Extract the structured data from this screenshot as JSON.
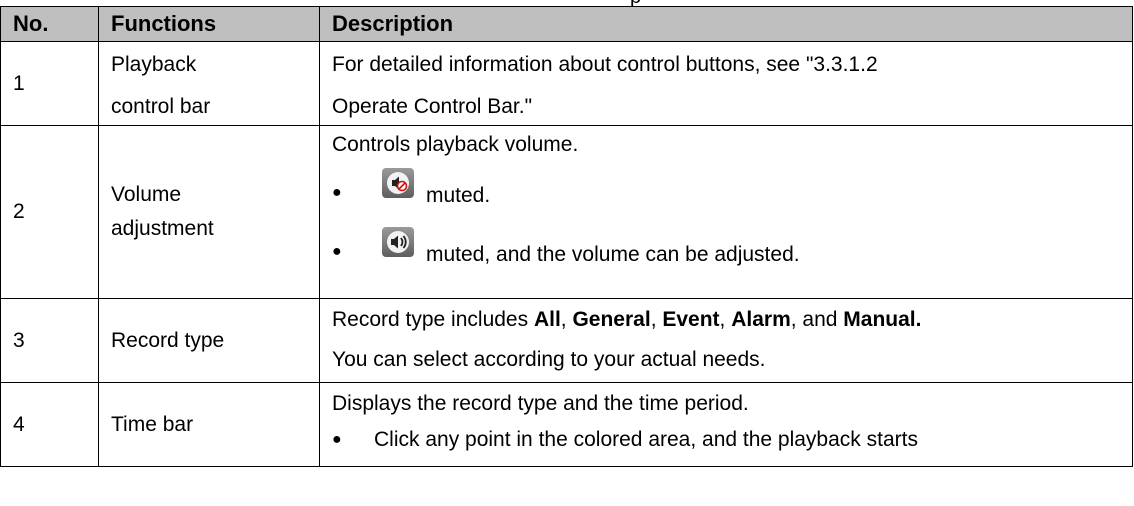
{
  "partial_header_text": "p",
  "table": {
    "headers": {
      "no": "No.",
      "functions": "Functions",
      "description": "Description"
    },
    "rows": [
      {
        "no": "1",
        "function_line1": "Playback",
        "function_line2": "control bar",
        "desc_line1": "For detailed information about control buttons, see \"3.3.1.2",
        "desc_line2": "Operate Control Bar.\""
      },
      {
        "no": "2",
        "function_line1": "Volume",
        "function_line2": "adjustment",
        "desc_line1": "Controls playback volume.",
        "bullet1_text": "muted.",
        "bullet1_icon": "speaker-muted-icon",
        "bullet2_text": "muted, and the volume can be adjusted.",
        "bullet2_icon": "speaker-unmuted-icon"
      },
      {
        "no": "3",
        "function": "Record type",
        "desc_prefix": "Record type includes ",
        "opt_all": "All",
        "sep1": ", ",
        "opt_general": "General",
        "sep2": ", ",
        "opt_event": "Event",
        "sep3": ", ",
        "opt_alarm": "Alarm",
        "sep4": ", and ",
        "opt_manual": "Manual.",
        "desc_line2": "You can select according to your actual needs."
      },
      {
        "no": "4",
        "function": "Time bar",
        "desc_line1": "Displays the record type and the time period.",
        "bullet_text": "Click any point in the colored area, and the playback starts"
      }
    ]
  },
  "colors": {
    "header_bg": "#bfbfbf",
    "border": "#000000",
    "icon_bg": "#7a7a7a"
  }
}
